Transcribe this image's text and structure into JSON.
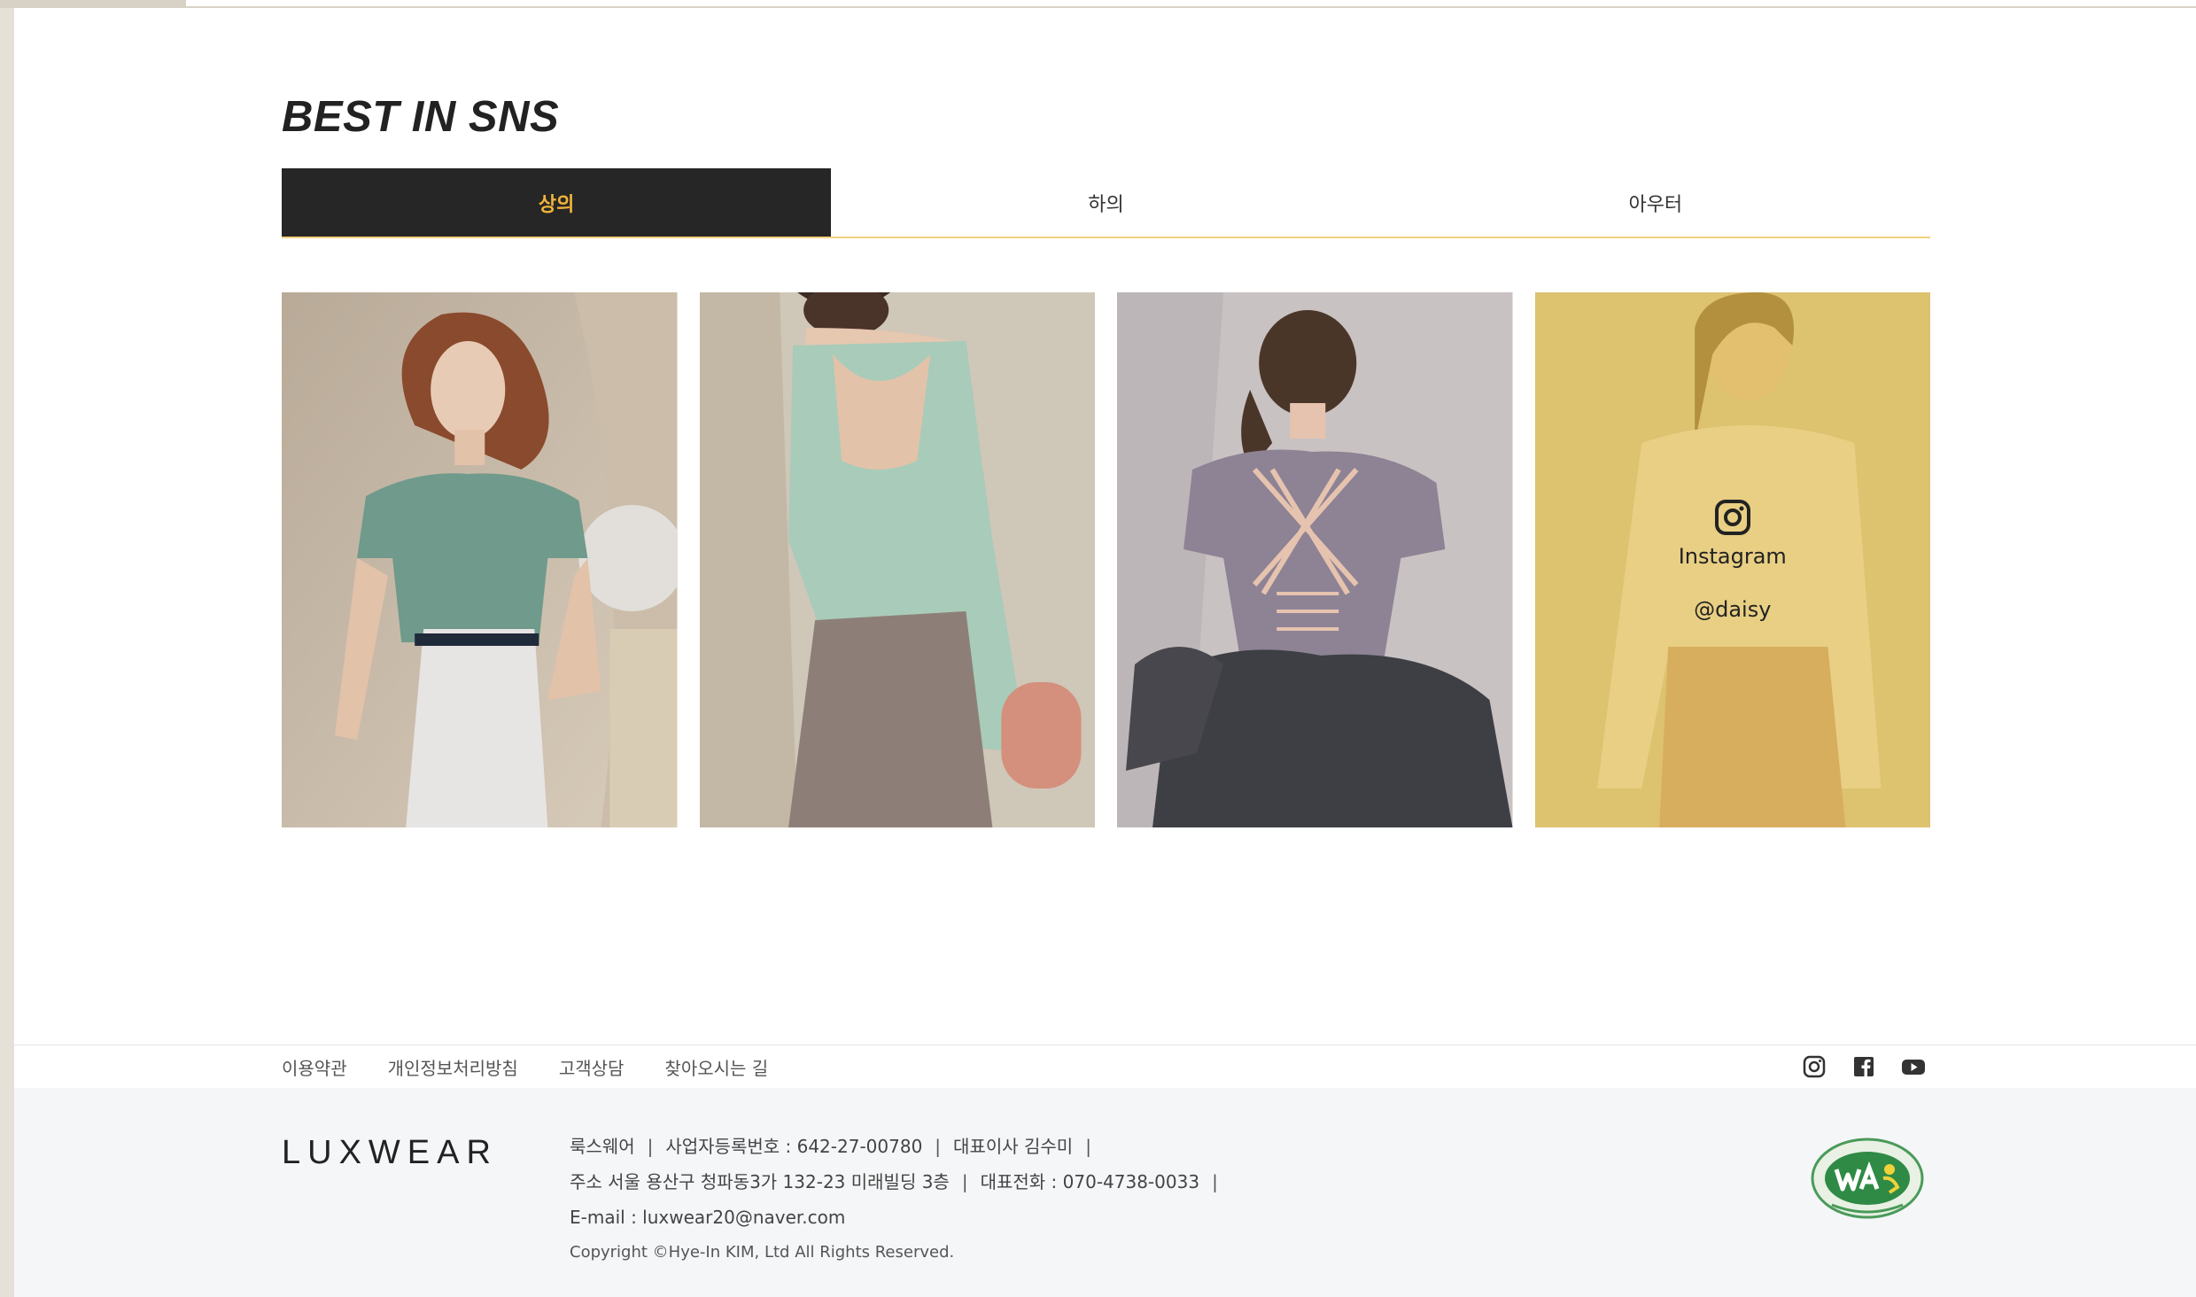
{
  "section": {
    "title": "BEST IN SNS"
  },
  "tabs": [
    {
      "label": "상의",
      "active": true
    },
    {
      "label": "하의",
      "active": false
    },
    {
      "label": "아우터",
      "active": false
    }
  ],
  "colors": {
    "tab_active_bg": "#262626",
    "tab_active_text": "#f0b43a",
    "tab_underline": "#f3d27a",
    "overlay": "#e1bc46"
  },
  "gallery": {
    "items": [
      {
        "icon": "photo-green-crop-top"
      },
      {
        "icon": "photo-mint-open-back-tank"
      },
      {
        "icon": "photo-lavender-strappy-top"
      },
      {
        "icon": "photo-cream-long-sleeve",
        "hover_overlay": {
          "icon": "instagram-icon",
          "label": "Instagram",
          "handle": "@daisy"
        }
      }
    ]
  },
  "footer": {
    "links": [
      "이용약관",
      "개인정보처리방침",
      "고객상담",
      "찾아오시는 길"
    ],
    "social": [
      "instagram-icon",
      "facebook-icon",
      "youtube-icon"
    ],
    "logo": "LUXWEAR",
    "company": {
      "name": "룩스웨어",
      "business_number": "사업자등록번호 : 642-27-00780",
      "ceo": "대표이사 김수미",
      "address": "주소 서울 용산구 청파동3가 132-23 미래빌딩 3층",
      "phone": "대표전화 : 070-4738-0033",
      "email": "E-mail : luxwear20@naver.com",
      "copyright": "Copyright ©Hye-In KIM, Ltd All Rights Reserved."
    },
    "badge": "web-accessibility-badge"
  }
}
